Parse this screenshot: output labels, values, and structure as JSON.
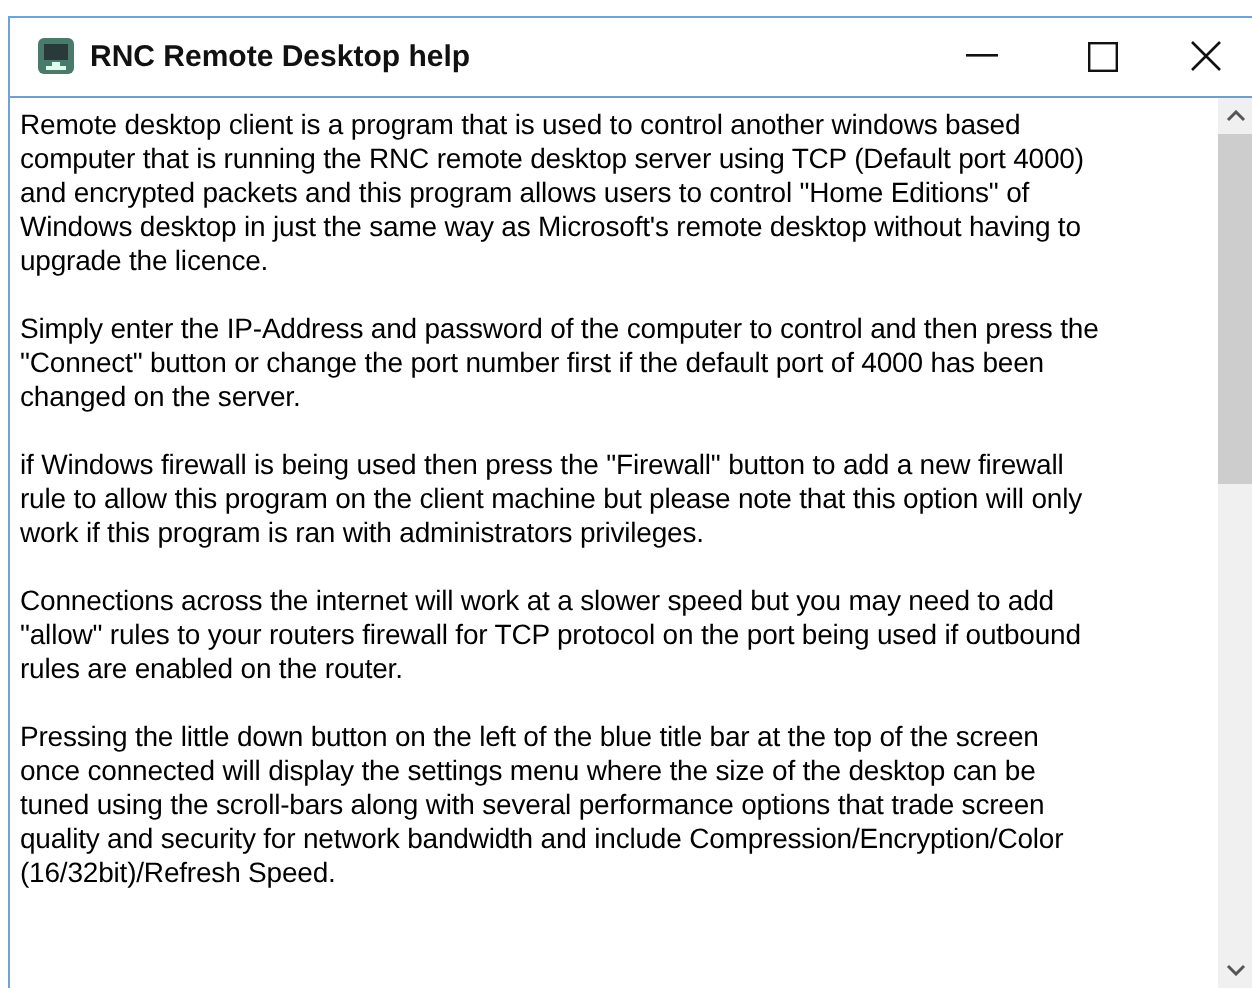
{
  "window": {
    "title": "RNC Remote Desktop help"
  },
  "paragraphs": [
    "Remote desktop client is a program that is used to control another windows based\ncomputer that is running the RNC remote desktop server using TCP (Default port 4000)\nand encrypted packets and this program allows users to control \"Home Editions\" of\nWindows desktop in just the same way as Microsoft's remote desktop without having to\nupgrade the licence.",
    "Simply enter the IP-Address and password of the computer to control and then press the\n\"Connect\" button or change the port number first if the default port of 4000 has been\nchanged on the server.",
    "if Windows firewall is being used then press the \"Firewall\" button to add a new firewall\nrule to allow this program on the client machine but please note that this option will only\nwork if this program is ran with administrators privileges.",
    "Connections across the internet will work at a slower speed but you may need to add\n\"allow\" rules to your routers firewall for TCP protocol on the port being used if outbound\nrules are enabled on the router.",
    "Pressing the little down button on the left of the blue title bar at the top of the screen\nonce connected will display the settings menu where the size of the desktop can be\ntuned using the scroll-bars along with several performance options that trade screen\nquality and security for network bandwidth and include Compression/Encryption/Color\n(16/32bit)/Refresh Speed."
  ]
}
